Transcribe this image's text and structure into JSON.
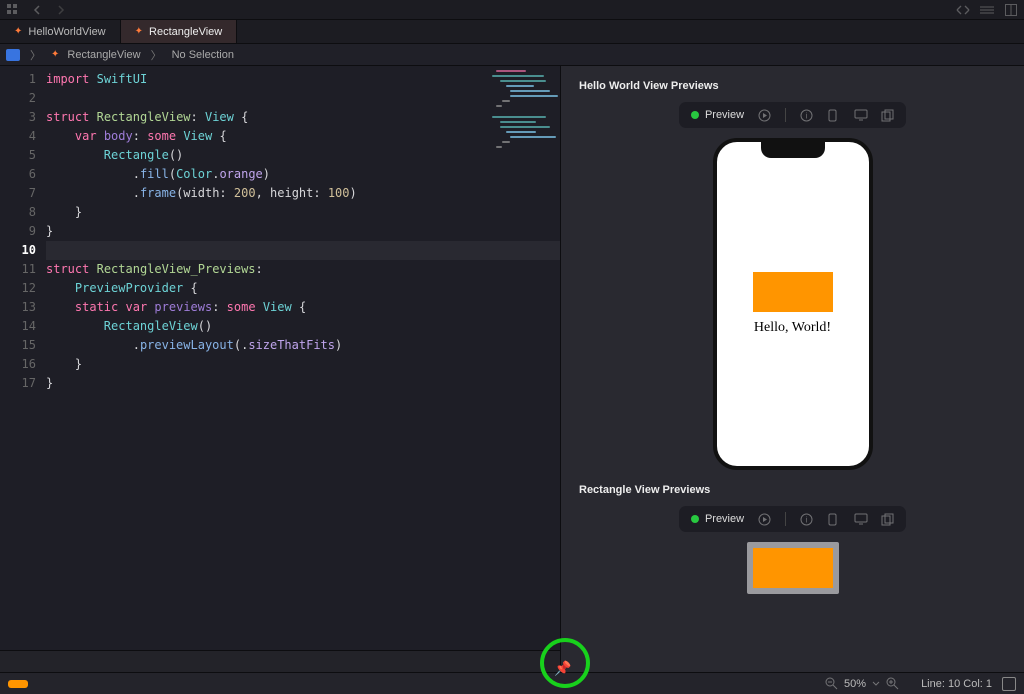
{
  "tabs": [
    {
      "label": "HelloWorldView",
      "active": false
    },
    {
      "label": "RectangleView",
      "active": true
    }
  ],
  "jump": {
    "file": "RectangleView",
    "sel": "No Selection"
  },
  "gutter": [
    "1",
    "2",
    "3",
    "4",
    "5",
    "6",
    "7",
    "8",
    "9",
    "10",
    "11",
    "",
    "12",
    "13",
    "14",
    "15",
    "16",
    "17"
  ],
  "active_line_index": 9,
  "code": {
    "l1": {
      "kw": "import",
      "ty": "SwiftUI"
    },
    "l3": {
      "kw": "struct",
      "id": "RectangleView",
      "col": ":",
      "ty": "View",
      "ob": "{"
    },
    "l4": {
      "kw": "var",
      "pr": "body",
      "col": ":",
      "kw2": "some",
      "ty": "View",
      "ob": "{"
    },
    "l5": {
      "ty": "Rectangle",
      "paren": "()"
    },
    "l6": {
      "dot": ".",
      "fn": "fill",
      "op": "(",
      "ty": "Color",
      "dot2": ".",
      "en": "orange",
      "cp": ")"
    },
    "l7": {
      "dot": ".",
      "fn": "frame",
      "op": "(",
      "a1": "width:",
      "n1": "200",
      "c": ",",
      "a2": "height:",
      "n2": "100",
      "cp": ")"
    },
    "l8": {
      "cb": "}"
    },
    "l9": {
      "cb": "}"
    },
    "l11a": {
      "kw": "struct",
      "id": "RectangleView_Previews",
      "col": ":"
    },
    "l11b": {
      "ty": "PreviewProvider",
      "ob": "{"
    },
    "l12": {
      "kw1": "static",
      "kw2": "var",
      "pr": "previews",
      "col": ":",
      "kw3": "some",
      "ty": "View",
      "ob": "{"
    },
    "l13": {
      "ty": "RectangleView",
      "paren": "()"
    },
    "l14": {
      "dot": ".",
      "fn": "previewLayout",
      "op": "(.",
      "en": "sizeThatFits",
      "cp": ")"
    },
    "l15": {
      "cb": "}"
    },
    "l16": {
      "cb": "}"
    }
  },
  "canvas": {
    "section1": "Hello World View Previews",
    "section2": "Rectangle View Previews",
    "preview_label": "Preview",
    "hello": "Hello, World!",
    "rect_color": "#ff9500"
  },
  "status": {
    "line_col": "Line: 10  Col: 1",
    "zoom": "50%"
  }
}
